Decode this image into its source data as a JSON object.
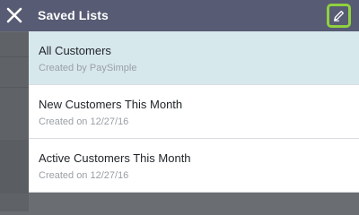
{
  "header": {
    "title": "Saved Lists",
    "close_icon": "close-icon",
    "edit_icon": "pencil-icon",
    "edit_highlight_color": "#8fd13f",
    "background_color": "#575b73"
  },
  "saved_lists": [
    {
      "title": "All Customers",
      "subtitle": "Created by PaySimple",
      "selected": true
    },
    {
      "title": "New Customers This Month",
      "subtitle": "Created on 12/27/16",
      "selected": false
    },
    {
      "title": "Active Customers This Month",
      "subtitle": "Created on 12/27/16",
      "selected": false
    }
  ],
  "colors": {
    "selected_row": "#d7e8ed",
    "subtitle_text": "#9aa0a6"
  }
}
